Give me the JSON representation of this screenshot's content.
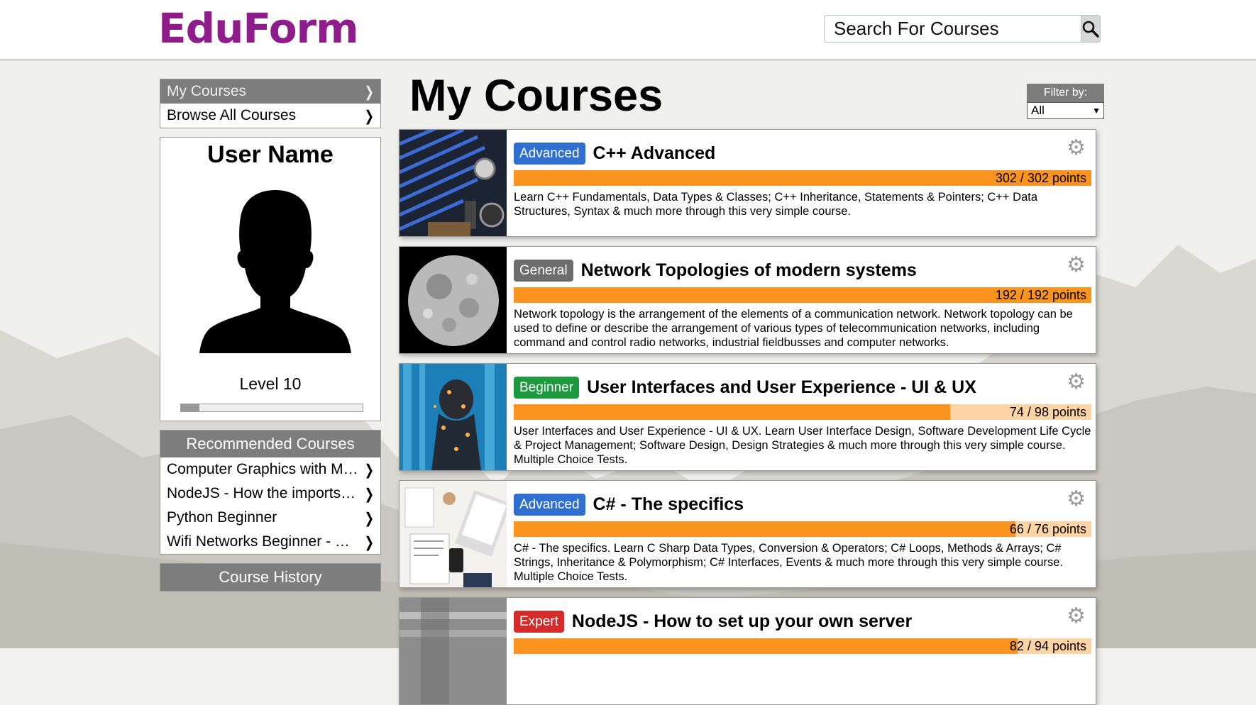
{
  "header": {
    "logo": "EduForm",
    "search_placeholder": "Search For Courses",
    "search_icon": "search-icon"
  },
  "sidebar": {
    "menu": [
      {
        "label": "My Courses",
        "active": true
      },
      {
        "label": "Browse All Courses",
        "active": false
      }
    ],
    "user": {
      "name": "User Name",
      "avatar_icon": "user-silhouette-icon",
      "level": "Level 10",
      "level_progress": 0.1
    },
    "recommended": {
      "title": "Recommended Courses",
      "items": [
        "Computer Graphics with Modern OpenGL and C++",
        "NodeJS - How the imports and exports work",
        "Python Beginner",
        "Wifi Networks Beginner - Security and Protocols"
      ]
    },
    "history": {
      "title": "Course History"
    }
  },
  "main": {
    "title": "My Courses",
    "filter": {
      "label": "Filter by:",
      "value": "All"
    },
    "courses": [
      {
        "badge": "Advanced",
        "badge_color": "#2f6fcf",
        "title": "C++ Advanced",
        "points_text": "302 / 302 points",
        "earned": 302,
        "total": 302,
        "description": "Learn C++ Fundamentals, Data Types & Classes; C++ Inheritance, Statements & Pointers; C++ Data Structures, Syntax & much more through this very simple course."
      },
      {
        "badge": "General",
        "badge_color": "#6d6d6d",
        "title": "Network Topologies of modern systems",
        "points_text": "192 / 192 points",
        "earned": 192,
        "total": 192,
        "description": "Network topology is the arrangement of the elements of a communication network. Network topology can be used to define or describe the arrangement of various types of telecommunication networks, including command and control radio networks, industrial fieldbusses and computer networks."
      },
      {
        "badge": "Beginner",
        "badge_color": "#1e9a3e",
        "title": "User Interfaces and User Experience - UI & UX",
        "points_text": "74 / 98 points",
        "earned": 74,
        "total": 98,
        "description": "User Interfaces and User Experience - UI & UX. Learn User Interface Design, Software Development Life Cycle & Project Management; Software Design, Design Strategies & much more through this very simple course. Multiple Choice Tests."
      },
      {
        "badge": "Advanced",
        "badge_color": "#2f6fcf",
        "title": "C# - The specifics",
        "points_text": "66 / 76 points",
        "earned": 66,
        "total": 76,
        "description": "C# - The specifics. Learn C Sharp Data Types, Conversion & Operators; C# Loops, Methods & Arrays; C# Strings, Inheritance & Polymorphism; C# Interfaces, Events & much more through this very simple course. Multiple Choice Tests."
      },
      {
        "badge": "Expert",
        "badge_color": "#d42b2b",
        "title": "NodeJS - How to set up your own server",
        "points_text": "82 / 94 points",
        "earned": 82,
        "total": 94,
        "description": ""
      }
    ]
  }
}
